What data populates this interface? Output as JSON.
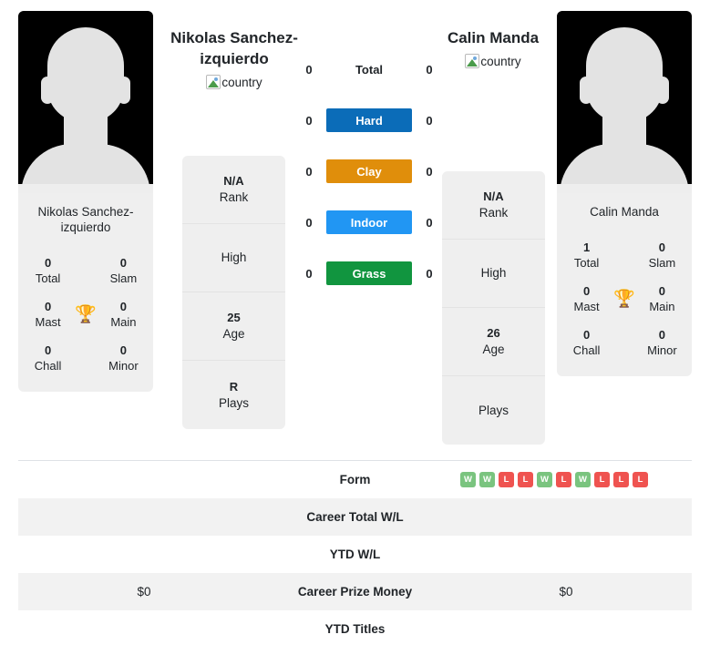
{
  "players": {
    "left": {
      "name": "Nikolas Sanchez-izquierdo",
      "card_name": "Nikolas Sanchez-izquierdo",
      "country_alt": "country",
      "titles": [
        {
          "value": "0",
          "label": "Total"
        },
        {
          "value": "0",
          "label": "Slam"
        },
        {
          "value": "0",
          "label": "Mast"
        },
        {
          "value": "0",
          "label": "Main"
        },
        {
          "value": "0",
          "label": "Chall"
        },
        {
          "value": "0",
          "label": "Minor"
        }
      ],
      "info": [
        {
          "value": "N/A",
          "label": "Rank"
        },
        {
          "value": "",
          "label": "High"
        },
        {
          "value": "25",
          "label": "Age"
        },
        {
          "value": "R",
          "label": "Plays"
        }
      ]
    },
    "right": {
      "name": "Calin Manda",
      "card_name": "Calin Manda",
      "country_alt": "country",
      "titles": [
        {
          "value": "1",
          "label": "Total"
        },
        {
          "value": "0",
          "label": "Slam"
        },
        {
          "value": "0",
          "label": "Mast"
        },
        {
          "value": "0",
          "label": "Main"
        },
        {
          "value": "0",
          "label": "Chall"
        },
        {
          "value": "0",
          "label": "Minor"
        }
      ],
      "info": [
        {
          "value": "N/A",
          "label": "Rank"
        },
        {
          "value": "",
          "label": "High"
        },
        {
          "value": "26",
          "label": "Age"
        },
        {
          "value": "",
          "label": "Plays"
        }
      ]
    }
  },
  "trophy_icon": "🏆",
  "surfaces": [
    {
      "label": "Total",
      "left": "0",
      "right": "0",
      "color": "transparent"
    },
    {
      "label": "Hard",
      "left": "0",
      "right": "0",
      "color": "#0b6cb8"
    },
    {
      "label": "Clay",
      "left": "0",
      "right": "0",
      "color": "#e08e0b"
    },
    {
      "label": "Indoor",
      "left": "0",
      "right": "0",
      "color": "#2196f3"
    },
    {
      "label": "Grass",
      "left": "0",
      "right": "0",
      "color": "#11953f"
    }
  ],
  "table": {
    "rows": [
      {
        "label": "Form",
        "left": "",
        "right": "",
        "type": "form"
      },
      {
        "label": "Career Total W/L",
        "left": "",
        "right": "",
        "type": "text"
      },
      {
        "label": "YTD W/L",
        "left": "",
        "right": "",
        "type": "text"
      },
      {
        "label": "Career Prize Money",
        "left": "$0",
        "right": "$0",
        "type": "text"
      },
      {
        "label": "YTD Titles",
        "left": "",
        "right": "",
        "type": "text"
      }
    ],
    "form_badges": [
      {
        "label": "W",
        "result": "win"
      },
      {
        "label": "W",
        "result": "win"
      },
      {
        "label": "L",
        "result": "loss"
      },
      {
        "label": "L",
        "result": "loss"
      },
      {
        "label": "W",
        "result": "win"
      },
      {
        "label": "L",
        "result": "loss"
      },
      {
        "label": "W",
        "result": "win"
      },
      {
        "label": "L",
        "result": "loss"
      },
      {
        "label": "L",
        "result": "loss"
      },
      {
        "label": "L",
        "result": "loss"
      }
    ]
  },
  "colors": {
    "win": "#7ac47f",
    "loss": "#ef5350",
    "hard": "#0b6cb8",
    "clay": "#e08e0b",
    "indoor": "#2196f3",
    "grass": "#11953f"
  }
}
